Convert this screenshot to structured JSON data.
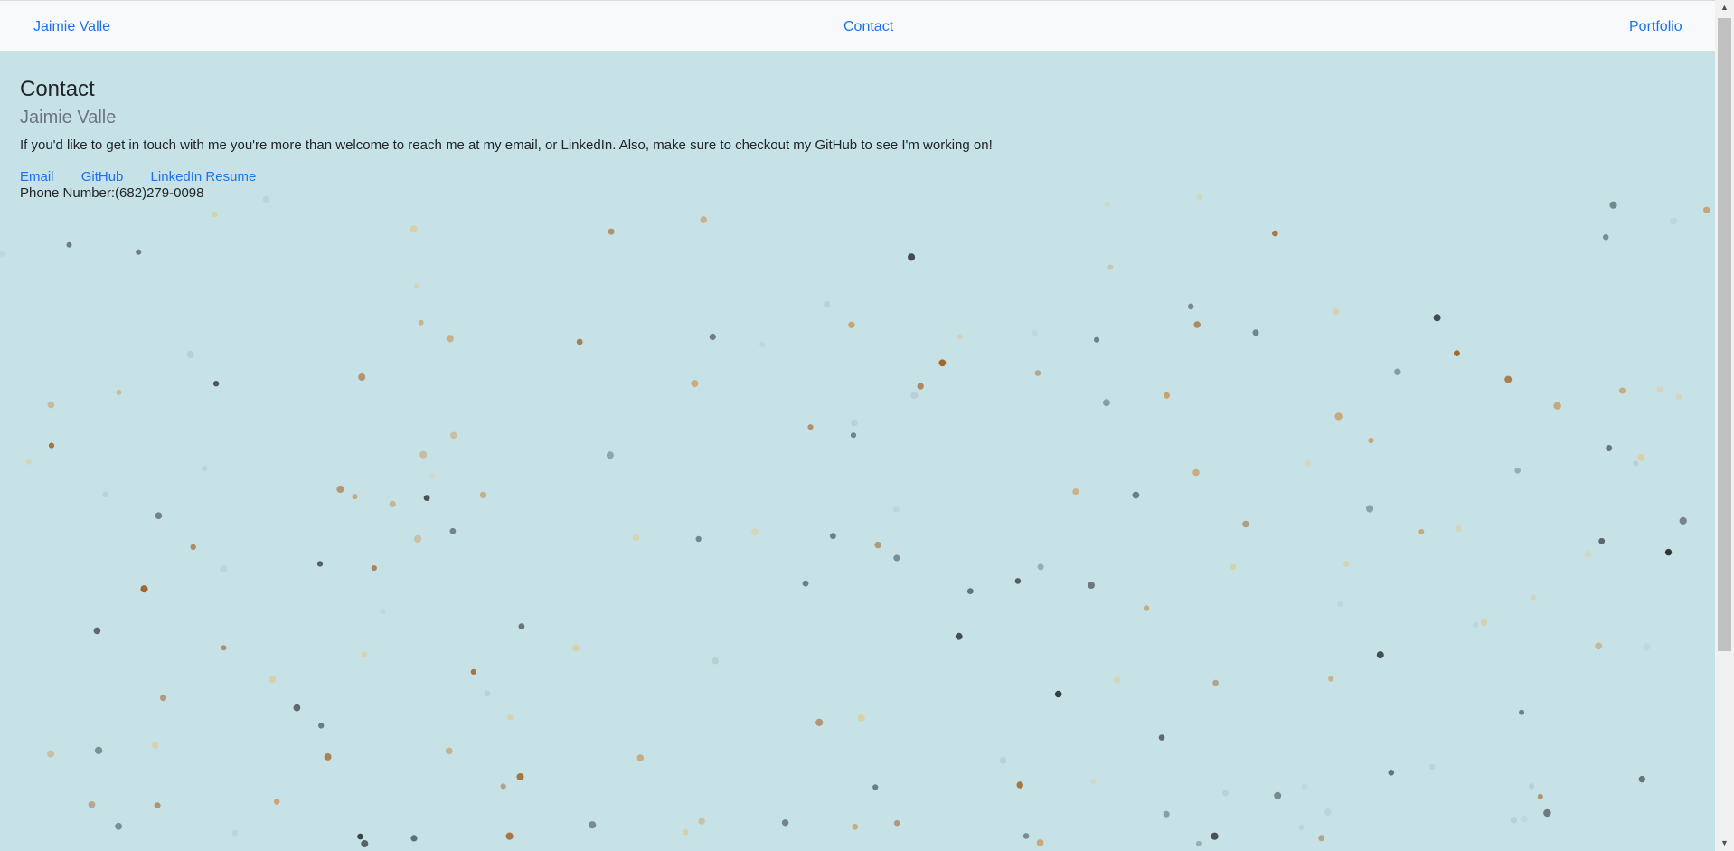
{
  "navbar": {
    "brand": "Jaimie Valle",
    "contact": "Contact",
    "portfolio": "Portfolio"
  },
  "page": {
    "title": "Contact",
    "subtitle": "Jaimie Valle",
    "intro": "If you'd like to get in touch with me you're more than welcome to reach me at my email, or LinkedIn. Also, make sure to checkout my GitHub to see I'm working on!",
    "links": {
      "email": "Email",
      "github": "GitHub",
      "linkedin": "LinkedIn Resume"
    },
    "phone": "Phone Number:(682)279-0098"
  },
  "scrollbar": {
    "up_icon": "triangle-up-icon",
    "down_icon": "triangle-down-icon"
  },
  "colors": {
    "background": "#c7e2e7",
    "navbar": "#f8f9fa",
    "link": "#1a73e8",
    "text": "#212529",
    "subtitle": "#6c757d",
    "dot_palette": [
      "#a0642a",
      "#c8a06a",
      "#2e3436",
      "#65757a",
      "#d9cfa5",
      "#b9cfd2"
    ]
  }
}
